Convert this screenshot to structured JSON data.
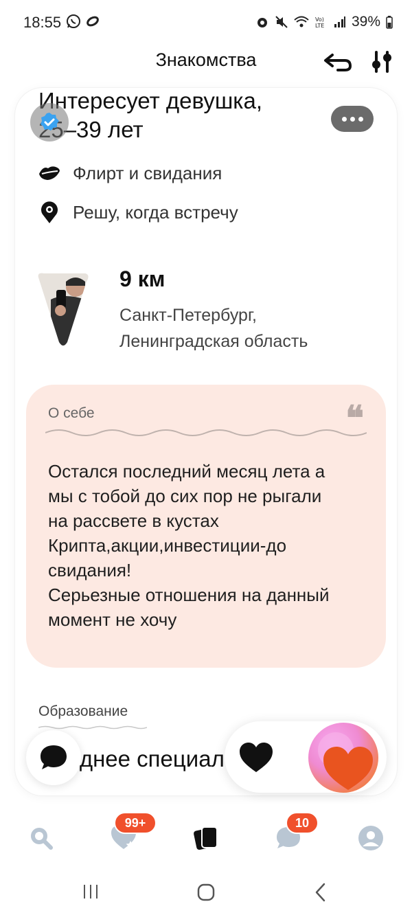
{
  "status_bar": {
    "time": "18:55",
    "battery": "39%",
    "icons": [
      "whatsapp-icon",
      "link-icon",
      "alarm-icon",
      "mute-icon",
      "wifi-icon",
      "volte-icon",
      "signal-icon",
      "battery-icon"
    ]
  },
  "header": {
    "title": "Знакомства",
    "icons": [
      "undo-icon",
      "filter-icon"
    ]
  },
  "profile": {
    "interest_line1": "Интересует девушка,",
    "interest_line2": "25–39 лет",
    "preferences": [
      {
        "icon": "lips-icon",
        "label": "Флирт и свидания"
      },
      {
        "icon": "eye-pin-icon",
        "label": "Решу, когда встречу"
      }
    ],
    "distance": "9 км",
    "city_line1": "Санкт-Петербург,",
    "city_line2": "Ленинградская область",
    "about": {
      "title": "О себе",
      "text": "Остался последний месяц лета а\nмы с тобой до сих пор не рыгали\nна рассвете в кустах\nКрипта,акции,инвестиции-до\nсвидания!\nСерьезные отношения на данный\nмомент не хочу"
    },
    "education": {
      "label": "Образование",
      "value": "Среднее специальное"
    }
  },
  "bottom_nav": {
    "items": [
      "search-icon",
      "likes-icon",
      "cards-icon",
      "messages-icon",
      "profile-icon"
    ],
    "likes_badge": "99+",
    "messages_badge": "10"
  },
  "colors": {
    "accent": "#f0502c",
    "about_bg": "#fde9e2",
    "nav_inactive": "#b9c6d3"
  }
}
